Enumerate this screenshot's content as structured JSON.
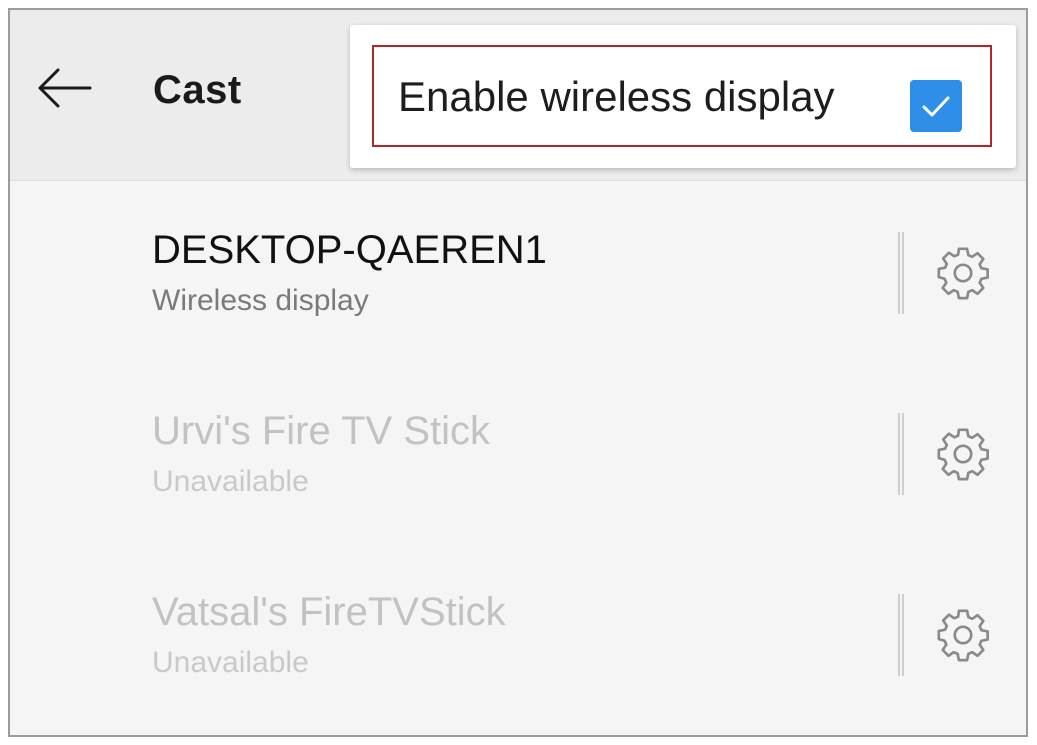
{
  "header": {
    "title": "Cast",
    "back_icon": "arrow-left-icon"
  },
  "popup": {
    "label": "Enable wireless display",
    "checked": true,
    "checkbox_color": "#2f8fe8",
    "highlight_color": "#b2262b"
  },
  "devices": [
    {
      "name": "DESKTOP-QAEREN1",
      "status": "Wireless display",
      "available": true,
      "settings_icon": "gear-icon"
    },
    {
      "name": "Urvi's Fire TV Stick",
      "status": "Unavailable",
      "available": false,
      "settings_icon": "gear-icon"
    },
    {
      "name": "Vatsal's FireTVStick",
      "status": "Unavailable",
      "available": false,
      "settings_icon": "gear-icon"
    }
  ]
}
